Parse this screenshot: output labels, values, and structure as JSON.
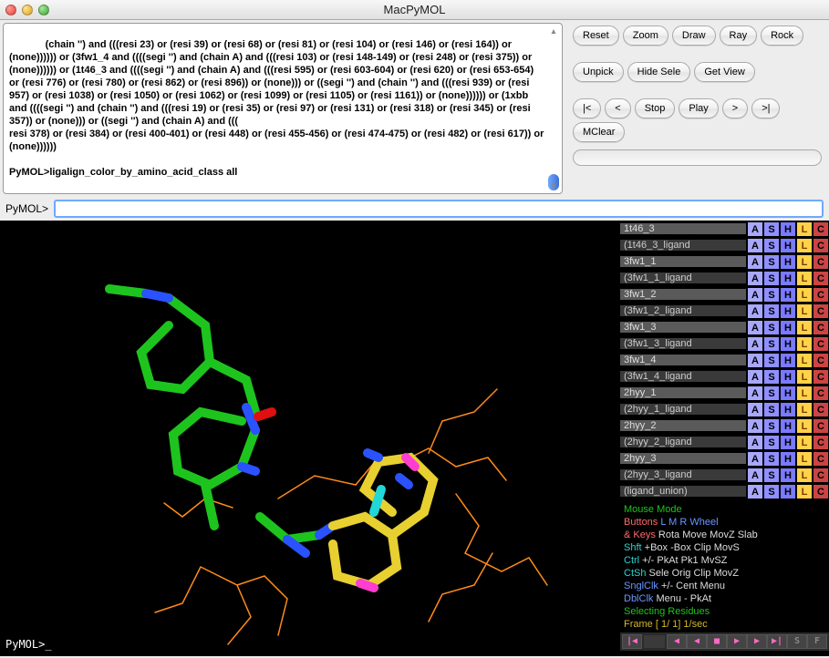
{
  "window": {
    "title": "MacPyMOL"
  },
  "log": "(chain '') and (((resi 23) or (resi 39) or (resi 68) or (resi 81) or (resi 104) or (resi 146) or (resi 164)) or (none)))))) or (3fw1_4 and ((((segi '') and (chain A) and (((resi 103) or (resi 148-149) or (resi 248) or (resi 375)) or (none)))))) or (1t46_3 and ((((segi '') and (chain A) and (((resi 595) or (resi 603-604) or (resi 620) or (resi 653-654) or (resi 776) or (resi 780) or (resi 862) or (resi 896)) or (none))) or ((segi '') and (chain '') and (((resi 939) or (resi 957) or (resi 1038) or (resi 1050) or (resi 1062) or (resi 1099) or (resi 1105) or (resi 1161)) or (none)))))) or (1xbb and ((((segi '') and (chain '') and (((resi 19) or (resi 35) or (resi 97) or (resi 131) or (resi 318) or (resi 345) or (resi 357)) or (none))) or ((segi '') and (chain A) and (((\nresi 378) or (resi 384) or (resi 400-401) or (resi 448) or (resi 455-456) or (resi 474-475) or (resi 482) or (resi 617)) or (none))))))\n\nPyMOL>ligalign_color_by_amino_acid_class all",
  "cmd": {
    "prompt": "PyMOL>",
    "value": ""
  },
  "viewer": {
    "prompt": "PyMOL>_"
  },
  "buttons": {
    "row1": [
      "Reset",
      "Zoom",
      "Draw",
      "Ray",
      "Rock"
    ],
    "row2": [
      "Unpick",
      "Hide Sele",
      "Get View"
    ],
    "row3": [
      "|<",
      "<",
      "Stop",
      "Play",
      ">",
      ">|",
      "MClear"
    ]
  },
  "objects": [
    {
      "name": "1t46_3",
      "sel": false,
      "on": true
    },
    {
      "name": "(1t46_3_ligand",
      "sel": true,
      "on": false
    },
    {
      "name": "3fw1_1",
      "sel": false,
      "on": true
    },
    {
      "name": "(3fw1_1_ligand",
      "sel": true,
      "on": false
    },
    {
      "name": "3fw1_2",
      "sel": false,
      "on": true
    },
    {
      "name": "(3fw1_2_ligand",
      "sel": true,
      "on": false
    },
    {
      "name": "3fw1_3",
      "sel": false,
      "on": true
    },
    {
      "name": "(3fw1_3_ligand",
      "sel": true,
      "on": false
    },
    {
      "name": "3fw1_4",
      "sel": false,
      "on": true
    },
    {
      "name": "(3fw1_4_ligand",
      "sel": true,
      "on": false
    },
    {
      "name": "2hyy_1",
      "sel": false,
      "on": true
    },
    {
      "name": "(2hyy_1_ligand",
      "sel": true,
      "on": false
    },
    {
      "name": "2hyy_2",
      "sel": false,
      "on": true
    },
    {
      "name": "(2hyy_2_ligand",
      "sel": true,
      "on": false
    },
    {
      "name": "2hyy_3",
      "sel": false,
      "on": true
    },
    {
      "name": "(2hyy_3_ligand",
      "sel": true,
      "on": false
    },
    {
      "name": "(ligand_union)",
      "sel": true,
      "on": false
    }
  ],
  "objcols": [
    "A",
    "S",
    "H",
    "L",
    "C"
  ],
  "mouse": {
    "title": "Mouse Mode",
    "hdr": [
      "Buttons",
      "L",
      "M",
      "R",
      "Wheel"
    ],
    "rows": [
      {
        "k": "& Keys",
        "v": [
          "Rota",
          "Move",
          "MovZ",
          "Slab"
        ]
      },
      {
        "k": "Shft",
        "v": [
          "+Box",
          "-Box",
          "Clip",
          "MovS"
        ]
      },
      {
        "k": "Ctrl",
        "v": [
          "+/-",
          "PkAt",
          "Pk1",
          "MvSZ"
        ]
      },
      {
        "k": "CtSh",
        "v": [
          "Sele",
          "Orig",
          "Clip",
          "MovZ"
        ]
      },
      {
        "k": "SnglClk",
        "v": [
          "+/-",
          "Cent",
          "Menu",
          ""
        ]
      },
      {
        "k": "DblClk",
        "v": [
          "Menu",
          "-",
          "PkAt",
          ""
        ]
      }
    ],
    "sel": "Selecting Residues",
    "frame": "Frame [   1/   1] 1/sec"
  },
  "transport": [
    "|◀",
    "◀",
    "◀",
    "■",
    "▶",
    "▶",
    "▶|",
    "S",
    "F"
  ]
}
